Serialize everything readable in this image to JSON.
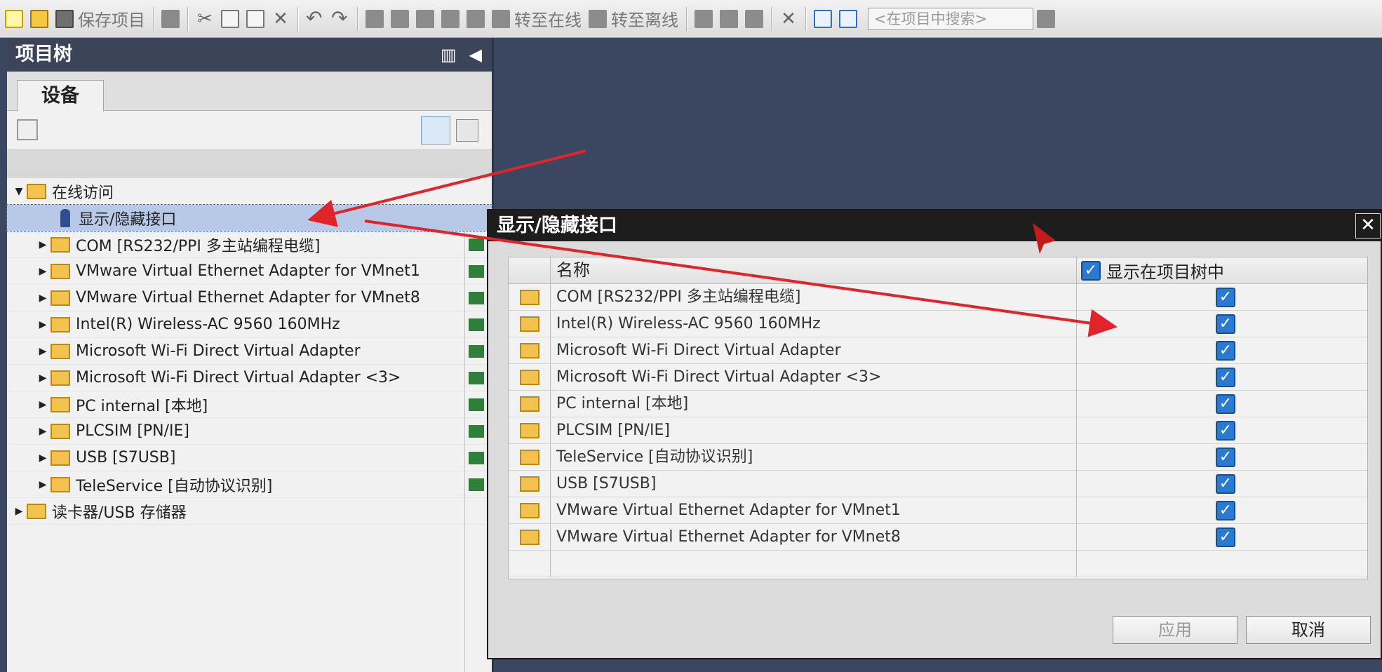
{
  "toolbar": {
    "save_label": "保存项目",
    "go_online_label": "转至在线",
    "go_offline_label": "转至离线",
    "search_placeholder": "<在项目中搜索>"
  },
  "project_tree": {
    "title": "项目树",
    "tab_label": "设备",
    "online_access": "在线访问",
    "show_hide_interfaces": "显示/隐藏接口",
    "items": [
      "COM [RS232/PPI 多主站编程电缆]",
      "VMware Virtual Ethernet Adapter for VMnet1",
      "VMware Virtual Ethernet Adapter for VMnet8",
      "Intel(R) Wireless-AC 9560 160MHz",
      "Microsoft Wi-Fi Direct Virtual Adapter",
      "Microsoft Wi-Fi Direct Virtual Adapter <3>",
      "PC internal [本地]",
      "PLCSIM [PN/IE]",
      "USB [S7USB]",
      "TeleService [自动协议识别]"
    ],
    "card_reader": "读卡器/USB 存储器"
  },
  "dialog": {
    "title": "显示/隐藏接口",
    "col_name": "名称",
    "col_show": "显示在项目树中",
    "rows": [
      {
        "name": "COM [RS232/PPI 多主站编程电缆]",
        "checked": true
      },
      {
        "name": "Intel(R) Wireless-AC 9560 160MHz",
        "checked": true
      },
      {
        "name": "Microsoft Wi-Fi Direct Virtual Adapter",
        "checked": true
      },
      {
        "name": "Microsoft Wi-Fi Direct Virtual Adapter <3>",
        "checked": true
      },
      {
        "name": "PC internal [本地]",
        "checked": true
      },
      {
        "name": "PLCSIM [PN/IE]",
        "checked": true
      },
      {
        "name": "TeleService [自动协议识别]",
        "checked": true
      },
      {
        "name": "USB [S7USB]",
        "checked": true
      },
      {
        "name": "VMware Virtual Ethernet Adapter for VMnet1",
        "checked": true
      },
      {
        "name": "VMware Virtual Ethernet Adapter for VMnet8",
        "checked": true
      }
    ],
    "apply_label": "应用",
    "cancel_label": "取消"
  },
  "colors": {
    "workspace_bg": "#3b4661",
    "annotation_red": "#e0242a",
    "checkbox_blue": "#2a7ad1"
  }
}
